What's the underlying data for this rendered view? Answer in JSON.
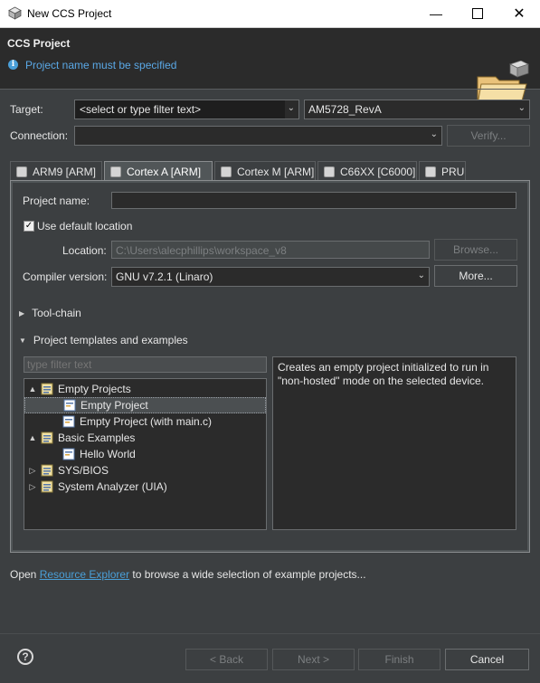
{
  "window": {
    "title": "New CCS Project",
    "minimize_icon": "minimize-icon",
    "maximize_icon": "maximize-icon",
    "close_icon": "close-icon"
  },
  "header": {
    "title": "CCS Project",
    "message": "Project name must be specified",
    "info_icon": "info-icon",
    "banner_icon": "project-folder-banner-icon"
  },
  "target": {
    "label": "Target:",
    "filter_value": "<select or type filter text>",
    "device_value": "AM5728_RevA"
  },
  "connection": {
    "label": "Connection:",
    "value": "",
    "verify_label": "Verify..."
  },
  "tabs": [
    {
      "label": "ARM9 [ARM]",
      "active": false
    },
    {
      "label": "Cortex A [ARM]",
      "active": true
    },
    {
      "label": "Cortex M [ARM]",
      "active": false
    },
    {
      "label": "C66XX [C6000]",
      "active": false
    },
    {
      "label": "PRU",
      "active": false
    }
  ],
  "project": {
    "name_label": "Project name:",
    "name_value": "",
    "use_default_label": "Use default location",
    "use_default_checked": true,
    "location_label": "Location:",
    "location_value": "C:\\Users\\alecphillips\\workspace_v8",
    "browse_label": "Browse...",
    "compiler_label": "Compiler version:",
    "compiler_value": "GNU v7.2.1 (Linaro)",
    "more_label": "More..."
  },
  "sections": {
    "toolchain": "Tool-chain",
    "templates": "Project templates and examples"
  },
  "templates": {
    "filter_placeholder": "type filter text",
    "tree": [
      {
        "label": "Empty Projects",
        "level": 0,
        "expanded": true,
        "twisty": "▲"
      },
      {
        "label": "Empty Project",
        "level": 1,
        "selected": true
      },
      {
        "label": "Empty Project (with main.c)",
        "level": 1
      },
      {
        "label": "Basic Examples",
        "level": 0,
        "expanded": true,
        "twisty": "▲"
      },
      {
        "label": "Hello World",
        "level": 1
      },
      {
        "label": "SYS/BIOS",
        "level": 0,
        "expanded": false,
        "twisty": "▷"
      },
      {
        "label": "System Analyzer (UIA)",
        "level": 0,
        "expanded": false,
        "twisty": "▷"
      }
    ],
    "description": "Creates an empty project initialized to run in \"non-hosted\" mode on the selected device."
  },
  "footer": {
    "open_prefix": "Open ",
    "resource_link": "Resource Explorer",
    "open_suffix": " to browse a wide selection of example projects...",
    "back": "< Back",
    "next": "Next >",
    "finish": "Finish",
    "cancel": "Cancel"
  },
  "colors": {
    "background": "#3c3f41",
    "header": "#2b2b2b",
    "accent": "#4a9fd8"
  }
}
